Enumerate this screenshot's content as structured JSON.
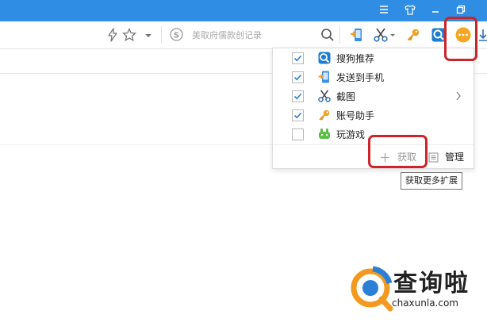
{
  "search": {
    "placeholder": "美取府儒款创记录"
  },
  "dropdown": {
    "items": [
      {
        "label": "搜狗推荐",
        "checked": true,
        "icon": "sogou-recommend-icon"
      },
      {
        "label": "发送到手机",
        "checked": true,
        "icon": "send-to-phone-icon"
      },
      {
        "label": "截图",
        "checked": true,
        "icon": "scissors-icon",
        "has_submenu": true
      },
      {
        "label": "账号助手",
        "checked": true,
        "icon": "key-icon"
      },
      {
        "label": "玩游戏",
        "checked": false,
        "icon": "game-controller-icon"
      }
    ],
    "get_label": "获取",
    "manage_label": "管理"
  },
  "tooltip": "获取更多扩展",
  "watermark": {
    "brand": "查询啦",
    "url": "chaxunla.com"
  },
  "colors": {
    "titlebar": "#2f8de4",
    "highlight": "#c9252a",
    "check": "#2f7fd2"
  }
}
